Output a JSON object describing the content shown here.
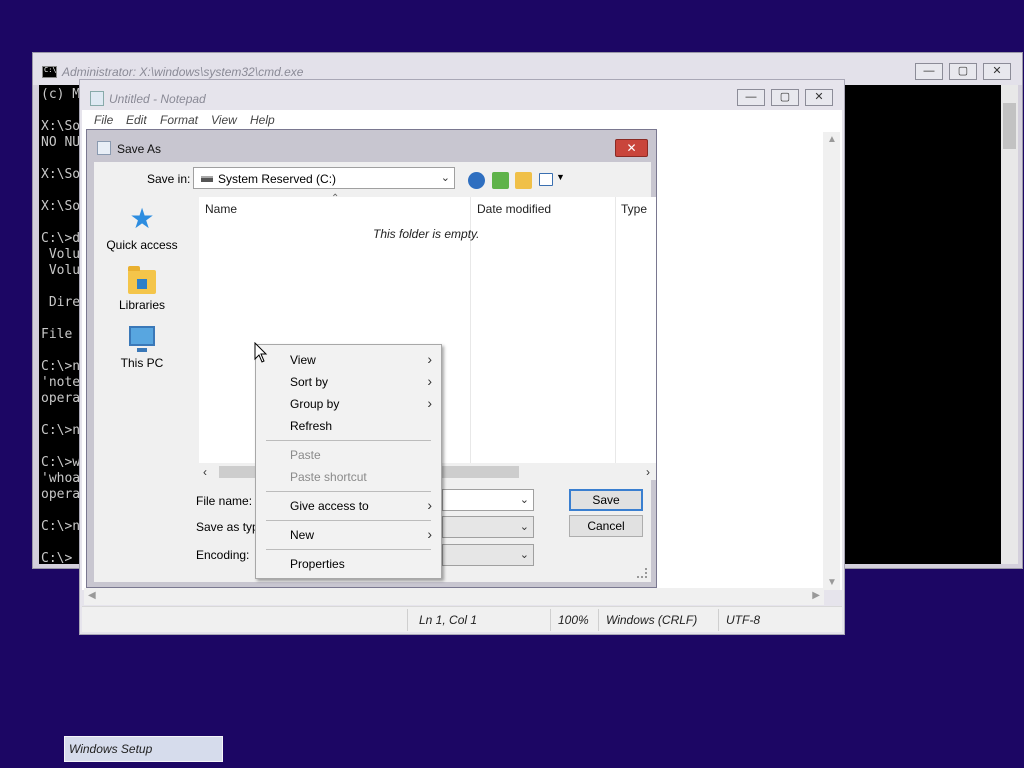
{
  "cmd": {
    "title": "Administrator: X:\\windows\\system32\\cmd.exe",
    "lines": [
      "(c) M",
      "",
      "X:\\So",
      "NO NU",
      "",
      "X:\\So",
      "",
      "X:\\So",
      "",
      "C:\\>d",
      " Volu",
      " Volu",
      "",
      " Dire",
      "",
      "File ",
      "",
      "C:\\>n",
      "'note",
      "opera",
      "",
      "C:\\>n",
      "",
      "C:\\>w",
      "'whoa",
      "opera",
      "",
      "C:\\>n",
      "",
      "C:\\> "
    ],
    "controls": {
      "minimize": "—",
      "maximize": "▢",
      "close": "✕"
    }
  },
  "notepad": {
    "title": "Untitled - Notepad",
    "menu": [
      "File",
      "Edit",
      "Format",
      "View",
      "Help"
    ],
    "status": {
      "position": "Ln 1, Col 1",
      "zoom": "100%",
      "line_ending": "Windows (CRLF)",
      "encoding": "UTF-8"
    },
    "controls": {
      "minimize": "—",
      "maximize": "▢",
      "close": "✕"
    }
  },
  "save_as": {
    "title": "Save As",
    "save_in_label": "Save in:",
    "save_in_value": "System Reserved (C:)",
    "places": [
      {
        "label": "Quick access",
        "icon": "star-icon"
      },
      {
        "label": "Libraries",
        "icon": "libraries-icon"
      },
      {
        "label": "This PC",
        "icon": "computer-icon"
      }
    ],
    "columns": [
      "Name",
      "Date modified",
      "Type"
    ],
    "empty_message": "This folder is empty.",
    "file_name_label": "File name:",
    "save_as_type_label": "Save as type",
    "encoding_label": "Encoding:",
    "save_button": "Save",
    "cancel_button": "Cancel"
  },
  "context_menu": {
    "items": [
      {
        "label": "View",
        "submenu": true,
        "disabled": false
      },
      {
        "label": "Sort by",
        "submenu": true,
        "disabled": false
      },
      {
        "label": "Group by",
        "submenu": true,
        "disabled": false
      },
      {
        "label": "Refresh",
        "submenu": false,
        "disabled": false
      },
      {
        "label": "Paste",
        "submenu": false,
        "disabled": true
      },
      {
        "label": "Paste shortcut",
        "submenu": false,
        "disabled": true
      },
      {
        "label": "Give access to",
        "submenu": true,
        "disabled": false
      },
      {
        "label": "New",
        "submenu": true,
        "disabled": false
      },
      {
        "label": "Properties",
        "submenu": false,
        "disabled": false
      }
    ]
  },
  "taskbar": {
    "setup_label": "Windows Setup"
  },
  "colors": {
    "desktop": "#1c0664",
    "close_button": "#c9453b",
    "accent": "#3a7fd0"
  }
}
